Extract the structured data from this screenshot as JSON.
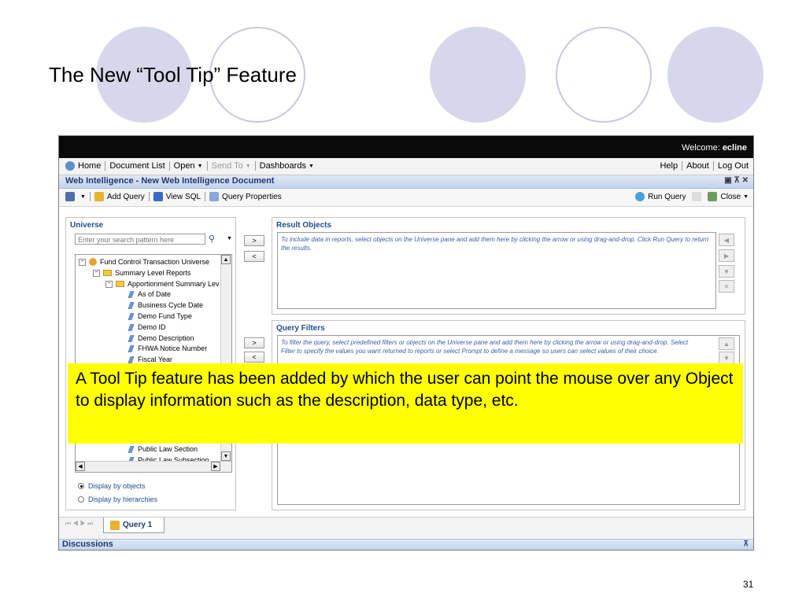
{
  "slide": {
    "title": "The New “Tool Tip” Feature",
    "page_number": "31",
    "callout": "A Tool Tip feature has been added by which the user can point the mouse over any Object to display information such as the description, data type, etc."
  },
  "topbar": {
    "welcome_label": "Welcome:",
    "username": "ecline"
  },
  "nav": {
    "home": "Home",
    "document_list": "Document List",
    "open": "Open",
    "send_to": "Send To",
    "dashboards": "Dashboards",
    "help": "Help",
    "about": "About",
    "log_out": "Log Out"
  },
  "document": {
    "title": "Web Intelligence - New Web Intelligence Document"
  },
  "toolbar": {
    "add_query": "Add Query",
    "view_sql": "View SQL",
    "query_properties": "Query Properties",
    "run_query": "Run Query",
    "close": "Close"
  },
  "universe": {
    "title": "Universe",
    "search_placeholder": "Enter your search pattern here",
    "tree": [
      "Fund Control Transaction Universe",
      "Summary Level Reports",
      "Apportionment Summary Lev",
      "As of Date",
      "Business Cycle Date",
      "Demo Fund Type",
      "Demo ID",
      "Demo Description",
      "FHWA Notice Number",
      "Fiscal Year",
      "Public Law Section",
      "Public Law Subsection"
    ],
    "display_by_objects": "Display by objects",
    "display_by_hierarchies": "Display by hierarchies"
  },
  "result_objects": {
    "title": "Result Objects",
    "hint": "To include data in reports, select objects on the Universe pane and add them here by clicking the arrow or using drag-and-drop. Click Run Query to return the results."
  },
  "query_filters": {
    "title": "Query Filters",
    "hint": "To filter the query, select predefined filters or objects on the Universe pane and add them here by clicking the arrow or using drag-and-drop. Select Filter to specify the values you want returned to reports or select Prompt to define a message so users can select values of their choice."
  },
  "tabs": {
    "query1": "Query 1"
  },
  "discussions": {
    "title": "Discussions"
  },
  "colors": {
    "accent": "#1f4e8f",
    "callout": "#ffff00",
    "circle": "#d7d7eb"
  }
}
